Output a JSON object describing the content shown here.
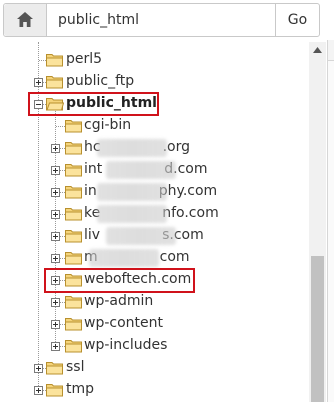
{
  "pathbar": {
    "home_icon": "home-icon",
    "path_value": "public_html",
    "go_label": "Go"
  },
  "tree": {
    "items": [
      {
        "id": "perl5",
        "label": "perl5",
        "level": 1,
        "toggle": "none"
      },
      {
        "id": "public_ftp",
        "label": "public_ftp",
        "level": 1,
        "toggle": "plus"
      },
      {
        "id": "public_html",
        "label": "public_html",
        "level": 1,
        "toggle": "minus",
        "open": true,
        "selected": true,
        "highlighted": true
      },
      {
        "id": "cgi-bin",
        "label": "cgi-bin",
        "level": 2,
        "toggle": "none"
      },
      {
        "id": "domain-1",
        "label": "hc...org",
        "label_start": "hc",
        "label_end": ".org",
        "level": 2,
        "toggle": "plus",
        "obscured": true
      },
      {
        "id": "domain-2",
        "label": "int...d.com",
        "label_start": "int",
        "label_end": "d.com",
        "level": 2,
        "toggle": "plus",
        "obscured": true
      },
      {
        "id": "domain-3",
        "label": "in...phy.com",
        "label_start": "in",
        "label_end": "phy.com",
        "level": 2,
        "toggle": "plus",
        "obscured": true
      },
      {
        "id": "domain-4",
        "label": "ke...nfo.com",
        "label_start": "ke",
        "label_end": "nfo.com",
        "level": 2,
        "toggle": "plus",
        "obscured": true
      },
      {
        "id": "domain-5",
        "label": "liv...s.com",
        "label_start": "liv",
        "label_end": "s.com",
        "level": 2,
        "toggle": "plus",
        "obscured": true
      },
      {
        "id": "domain-6",
        "label": "m...com",
        "label_start": "m",
        "label_end": "com",
        "level": 2,
        "toggle": "plus",
        "obscured": true
      },
      {
        "id": "weboftech",
        "label": "weboftech.com",
        "level": 2,
        "toggle": "plus",
        "highlighted": true
      },
      {
        "id": "wp-admin",
        "label": "wp-admin",
        "level": 2,
        "toggle": "plus"
      },
      {
        "id": "wp-content",
        "label": "wp-content",
        "level": 2,
        "toggle": "plus"
      },
      {
        "id": "wp-includes",
        "label": "wp-includes",
        "level": 2,
        "toggle": "plus"
      },
      {
        "id": "ssl",
        "label": "ssl",
        "level": 1,
        "toggle": "plus"
      },
      {
        "id": "tmp",
        "label": "tmp",
        "level": 1,
        "toggle": "plus"
      }
    ]
  },
  "colors": {
    "highlight_border": "#d0121b",
    "folder_fill": "#f5d47a",
    "folder_stroke": "#b8902e",
    "text": "#333333"
  }
}
